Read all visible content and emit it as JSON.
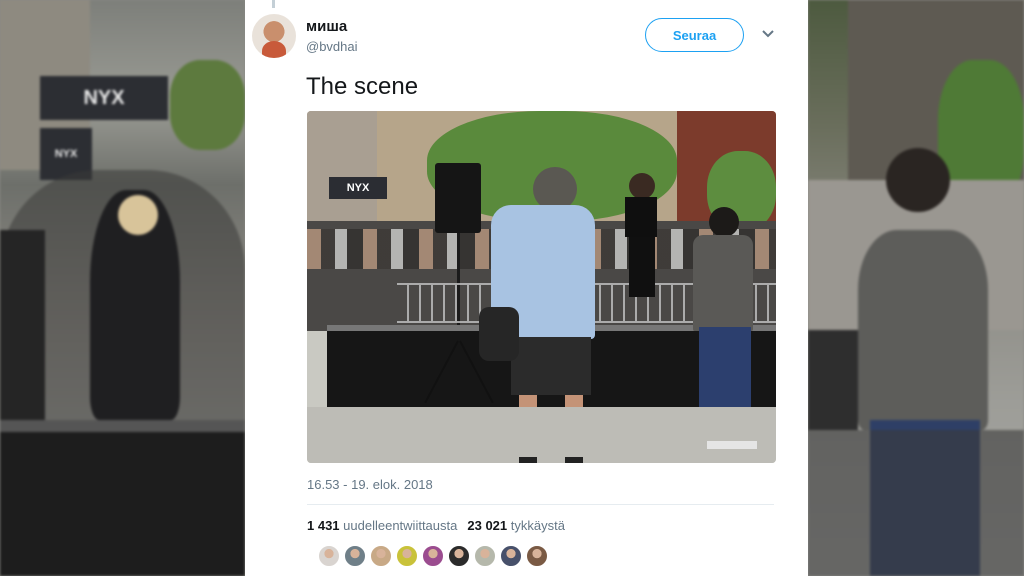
{
  "background": {
    "left_signs": [
      "NYX",
      "NYX"
    ]
  },
  "tweet": {
    "author_name": "миша",
    "author_handle": "@bvdhai",
    "follow_label": "Seuraa",
    "menu_icon": "chevron-down-icon",
    "text": "The scene",
    "photo_sign": "NYX",
    "timestamp": "16.53 - 19. elok. 2018",
    "retweets_count": "1 431",
    "retweets_label": "uudelleentwiittausta",
    "likes_count": "23 021",
    "likes_label": "tykkäystä",
    "liker_avatar_colors": [
      "#d9d4d0",
      "#6f7f88",
      "#c8a986",
      "#c9c23a",
      "#9b4c8f",
      "#2b2b2b",
      "#b5b8ab",
      "#47506a",
      "#7a5a44"
    ]
  },
  "colors": {
    "accent": "#1da1f2",
    "text_primary": "#14171a",
    "text_secondary": "#657786"
  }
}
